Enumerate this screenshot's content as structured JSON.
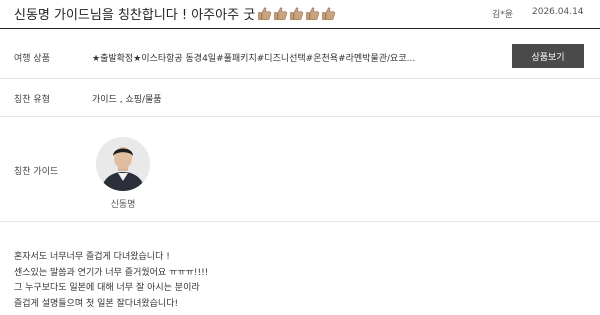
{
  "header": {
    "title": "신동명 가이드님을 칭찬합니다 ! 아주아주 굿",
    "thumbs_icon": "thumbs-up-icon",
    "thumbs_count": 5,
    "author": "김*윤",
    "date": "2026.04.14"
  },
  "product": {
    "label": "여행 상품",
    "value": "★출발확정★이스타항공 동경4일#풀패키지#디즈니선택#온천욕#라멘박물관/요코...",
    "button_label": "상품보기"
  },
  "praise_type": {
    "label": "칭찬 유형",
    "value": "가이드 , 쇼핑/물품"
  },
  "praise_guide": {
    "label": "칭찬 가이드",
    "name": "신동명"
  },
  "review": {
    "lines": [
      "혼자서도 너무너무 즐겁게 다녀왔습니다 !",
      "센스있는 말씀과 연기가 너무 즐거웠어요 ㅠㅠㅠ!!!!",
      "그 누구보다도 일본에 대해 너무 잘 아시는 분이라",
      "즐겁게 설명들으며 첫 일본 잘다녀왔습니다!"
    ]
  },
  "colors": {
    "button_bg": "#4a4a4a",
    "thumb_fill": "#c9a27e"
  }
}
